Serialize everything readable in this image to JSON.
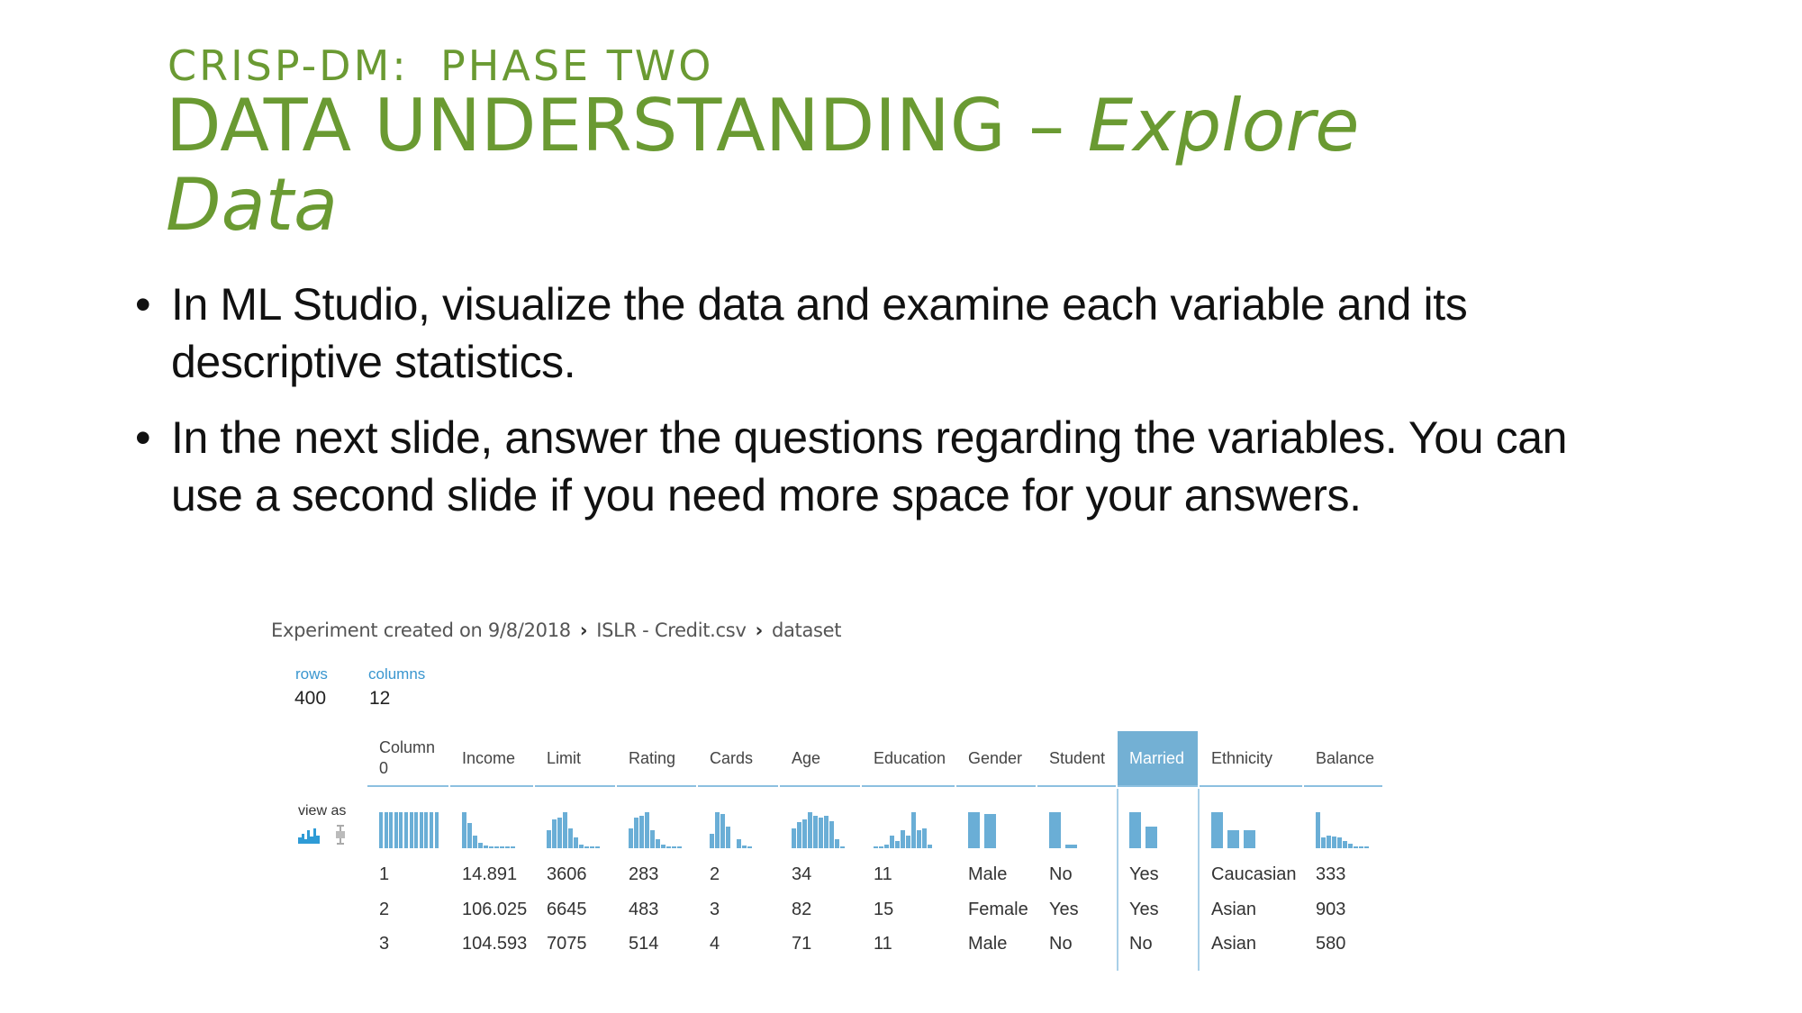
{
  "slide": {
    "kicker": "CRISP-DM:  PHASE TWO",
    "title_main": "DATA UNDERSTANDING – ",
    "title_italic": "Explore Data",
    "bullets": [
      "In ML Studio, visualize the data and examine each variable and its descriptive statistics.",
      "In the next slide, answer the questions regarding the variables. You can use a second slide if you need more space for your answers."
    ],
    "bullet_glyph": "•"
  },
  "screenshot": {
    "breadcrumb": [
      "Experiment created on 9/8/2018",
      "ISLR - Credit.csv",
      "dataset"
    ],
    "breadcrumb_sep": "›",
    "rows_label": "rows",
    "rows_value": "400",
    "columns_label": "columns",
    "columns_value": "12",
    "view_as_label": "view as",
    "view_as_icons": [
      "histogram-icon",
      "boxplot-icon"
    ],
    "colors": {
      "accent": "#6aaed6",
      "selected_header": "#73b0d4",
      "title": "#6a9a32",
      "label": "#3a96cf"
    },
    "selected_column": "Married",
    "columns": [
      {
        "name": "Column 0",
        "hist": [
          1,
          1,
          1,
          1,
          1,
          1,
          1,
          1,
          1,
          1,
          1,
          1
        ],
        "values": [
          "1",
          "2",
          "3"
        ]
      },
      {
        "name": "Income",
        "hist": [
          1,
          0.7,
          0.35,
          0.15,
          0.07,
          0.05,
          0.03,
          0.02,
          0.02,
          0.01
        ],
        "values": [
          "14.891",
          "106.025",
          "104.593"
        ]
      },
      {
        "name": "Limit",
        "hist": [
          0.5,
          0.8,
          0.85,
          1,
          0.55,
          0.3,
          0.1,
          0.05,
          0.03,
          0.02
        ],
        "values": [
          "3606",
          "6645",
          "7075"
        ]
      },
      {
        "name": "Rating",
        "hist": [
          0.55,
          0.85,
          0.9,
          1,
          0.5,
          0.25,
          0.1,
          0.05,
          0.03,
          0.02
        ],
        "values": [
          "283",
          "483",
          "514"
        ]
      },
      {
        "name": "Cards",
        "hist": [
          0.4,
          1,
          0.95,
          0.6,
          0,
          0.25,
          0.08,
          0.02
        ],
        "values": [
          "2",
          "3",
          "4"
        ]
      },
      {
        "name": "Age",
        "hist": [
          0.55,
          0.72,
          0.8,
          1,
          0.9,
          0.85,
          0.9,
          0.75,
          0.25,
          0.02
        ],
        "values": [
          "34",
          "82",
          "71"
        ]
      },
      {
        "name": "Education",
        "hist": [
          0.05,
          0.05,
          0.1,
          0.35,
          0.2,
          0.5,
          0.35,
          1,
          0.5,
          0.55,
          0.1
        ],
        "values": [
          "11",
          "15",
          "11"
        ]
      },
      {
        "name": "Gender",
        "hist": [
          1,
          0.95
        ],
        "values": [
          "Male",
          "Female",
          "Male"
        ]
      },
      {
        "name": "Student",
        "hist": [
          1,
          0.1
        ],
        "values": [
          "No",
          "Yes",
          "No"
        ]
      },
      {
        "name": "Married",
        "hist": [
          1,
          0.6
        ],
        "values": [
          "Yes",
          "Yes",
          "No"
        ]
      },
      {
        "name": "Ethnicity",
        "hist": [
          1,
          0.5,
          0.5
        ],
        "values": [
          "Caucasian",
          "Asian",
          "Asian"
        ]
      },
      {
        "name": "Balance",
        "hist": [
          1,
          0.3,
          0.35,
          0.33,
          0.3,
          0.2,
          0.12,
          0.05,
          0.03,
          0.02
        ],
        "values": [
          "333",
          "903",
          "580"
        ]
      }
    ]
  }
}
